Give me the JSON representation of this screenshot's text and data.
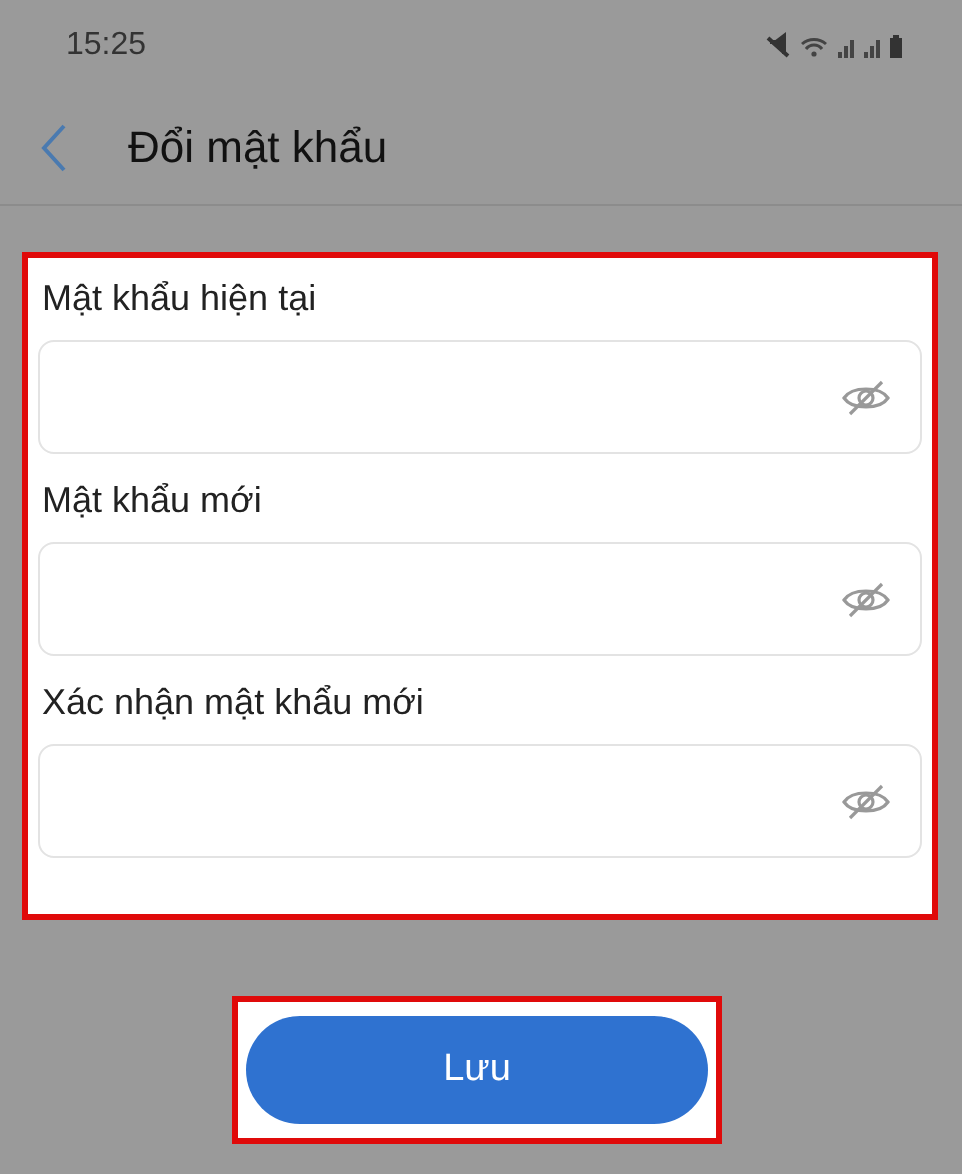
{
  "status_bar": {
    "time": "15:25"
  },
  "header": {
    "title": "Đổi mật khẩu"
  },
  "fields": [
    {
      "label": "Mật khẩu hiện tại",
      "password_visible": false
    },
    {
      "label": "Mật khẩu mới",
      "password_visible": false
    },
    {
      "label": "Xác nhận mật khẩu mới",
      "password_visible": false
    }
  ],
  "save_button": {
    "label": "Lưu"
  }
}
